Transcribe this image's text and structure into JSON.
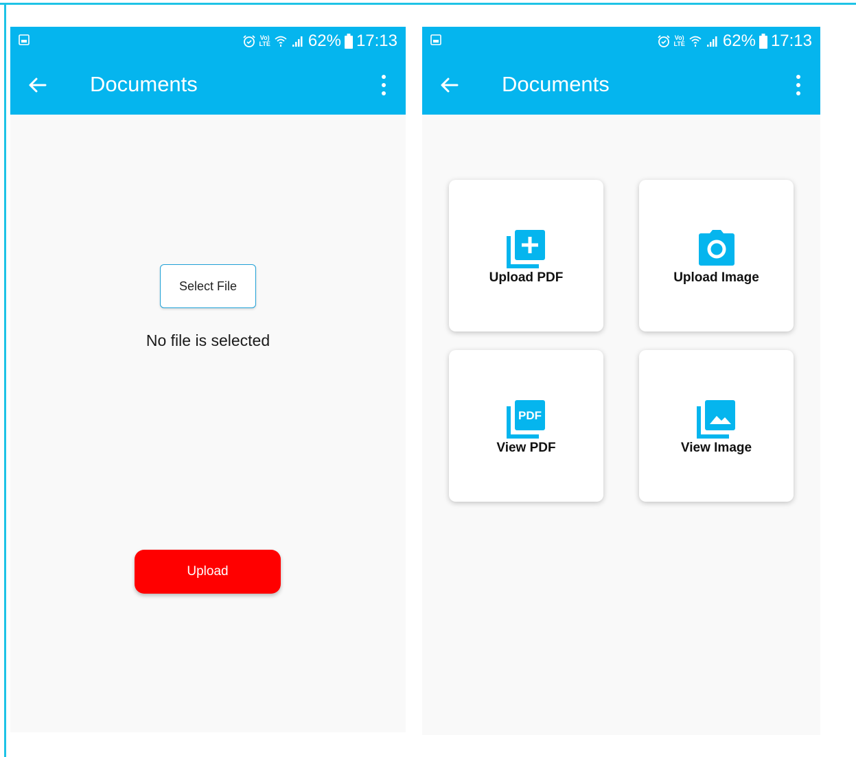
{
  "status_bar": {
    "battery": "62%",
    "time": "17:13",
    "volte_top": "Vo)",
    "volte_bottom": "LTE"
  },
  "screen_1": {
    "title": "Documents",
    "select_file_label": "Select File",
    "status_text": "No file is selected",
    "upload_label": "Upload"
  },
  "screen_2": {
    "title": "Documents",
    "cards": [
      {
        "label": "Upload PDF",
        "icon": "add-pdf-icon"
      },
      {
        "label": "Upload Image",
        "icon": "camera-icon"
      },
      {
        "label": "View PDF",
        "icon": "pdf-icon"
      },
      {
        "label": "View Image",
        "icon": "image-gallery-icon"
      }
    ]
  },
  "colors": {
    "appbar": "#05b5ee",
    "icon_blue": "#05b5ee",
    "upload_button": "#ff0000",
    "background": "#f9f9f9"
  }
}
